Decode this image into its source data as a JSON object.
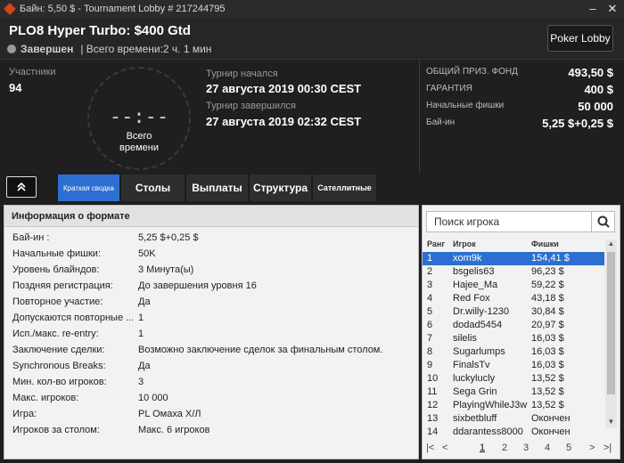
{
  "titlebar": {
    "title": "Байн: 5,50 $ - Tournament Lobby # 217244795"
  },
  "header": {
    "title": "PLO8 Hyper Turbo: $400 Gtd",
    "state": "Завершен",
    "total_time": "| Всего времени:2 ч. 1 мин",
    "poker_lobby_btn": "Poker Lobby"
  },
  "info": {
    "participants_label": "Участники",
    "participants_value": "94",
    "clock_digits": "--:--",
    "clock_caption_1": "Всего",
    "clock_caption_2": "времени",
    "started_label": "Турнир начался",
    "started_value": "27 августа 2019  00:30 CEST",
    "ended_label": "Турнир завершился",
    "ended_value": "27 августа 2019  02:32 CEST"
  },
  "prize": [
    {
      "label": "ОБЩИЙ ПРИЗ. ФОНД",
      "value": "493,50 $"
    },
    {
      "label": "ГАРАНТИЯ",
      "value": "400 $"
    },
    {
      "label": "Начальные фишки",
      "value": "50 000"
    },
    {
      "label": "Бай-ин",
      "value": "5,25 $+0,25 $"
    }
  ],
  "tabs": [
    {
      "label": "Краткая сводка",
      "active": true
    },
    {
      "label": "Столы"
    },
    {
      "label": "Выплаты"
    },
    {
      "label": "Структура"
    },
    {
      "label": "Сателлитные"
    }
  ],
  "format": {
    "heading": "Информация о формате",
    "rows": [
      {
        "k": "Бай-ин :",
        "v": "5,25 $+0,25 $"
      },
      {
        "k": "Начальные фишки:",
        "v": "50K"
      },
      {
        "k": "Уровень блайндов:",
        "v": "3 Минута(ы)"
      },
      {
        "k": "Поздняя регистрация:",
        "v": "До завершения уровня 16"
      },
      {
        "k": "Повторное участие:",
        "v": "Да"
      },
      {
        "k": "Допускаются повторные ...",
        "v": "1"
      },
      {
        "k": "Исп./макс. re-entry:",
        "v": "1"
      },
      {
        "k": "Заключение сделки:",
        "v": "Возможно заключение сделок за финальным столом."
      },
      {
        "k": "Synchronous Breaks:",
        "v": "Да"
      },
      {
        "k": "Мин. кол-во игроков:",
        "v": "3"
      },
      {
        "k": "Макс. игроков:",
        "v": "10 000"
      },
      {
        "k": "Игра:",
        "v": "PL Омаха Х/Л"
      },
      {
        "k": "Игроков за столом:",
        "v": "Макс. 6 игроков"
      }
    ]
  },
  "players": {
    "search_placeholder": "Поиск игрока",
    "col_rank": "Ранг",
    "col_player": "Игрок",
    "col_chips": "Фишки",
    "rows": [
      {
        "r": "1",
        "n": "xom9k",
        "c": "154,41 $"
      },
      {
        "r": "2",
        "n": "bsgelis63",
        "c": "96,23 $"
      },
      {
        "r": "3",
        "n": "Hajee_Ma",
        "c": "59,22 $"
      },
      {
        "r": "4",
        "n": "Red Fox",
        "c": "43,18 $"
      },
      {
        "r": "5",
        "n": "Dr.willy-1230",
        "c": "30,84 $"
      },
      {
        "r": "6",
        "n": "dodad5454",
        "c": "20,97 $"
      },
      {
        "r": "7",
        "n": "silelis",
        "c": "16,03 $"
      },
      {
        "r": "8",
        "n": "Sugarlumps",
        "c": "16,03 $"
      },
      {
        "r": "9",
        "n": "FinalsTv",
        "c": "16,03 $"
      },
      {
        "r": "10",
        "n": "luckylucly",
        "c": "13,52 $"
      },
      {
        "r": "11",
        "n": "Sega Grin",
        "c": "13,52 $"
      },
      {
        "r": "12",
        "n": "PlayingWhileJ3w",
        "c": "13,52 $"
      },
      {
        "r": "13",
        "n": "sixbetbluff",
        "c": "Окончен"
      },
      {
        "r": "14",
        "n": "ddarantess8000",
        "c": "Окончен"
      }
    ],
    "pages": [
      "1",
      "2",
      "3",
      "4",
      "5"
    ]
  }
}
